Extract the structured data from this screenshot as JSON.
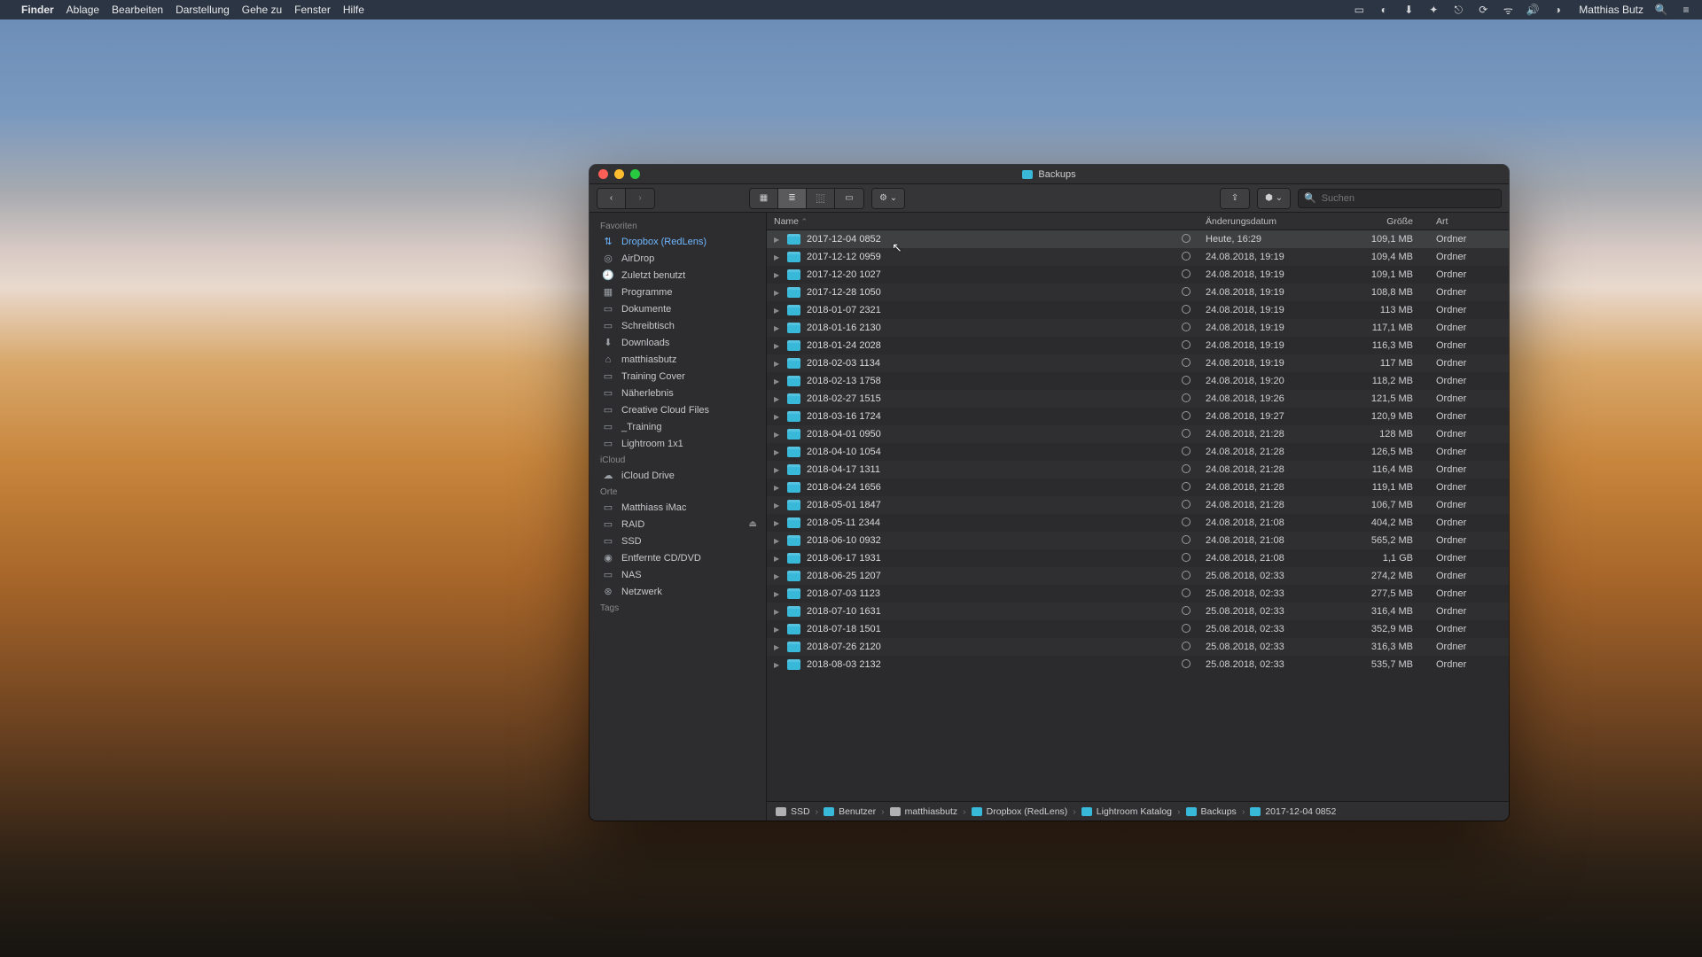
{
  "menubar": {
    "app": "Finder",
    "items": [
      "Ablage",
      "Bearbeiten",
      "Darstellung",
      "Gehe zu",
      "Fenster",
      "Hilfe"
    ],
    "user": "Matthias Butz"
  },
  "window": {
    "title": "Backups"
  },
  "toolbar": {
    "search_placeholder": "Suchen"
  },
  "sidebar": {
    "groups": {
      "fav": "Favoriten",
      "icloud": "iCloud",
      "orte": "Orte",
      "tags": "Tags"
    },
    "fav": [
      {
        "icon": "⇅",
        "label": "Dropbox (RedLens)",
        "sel": true
      },
      {
        "icon": "◎",
        "label": "AirDrop"
      },
      {
        "icon": "🕘",
        "label": "Zuletzt benutzt"
      },
      {
        "icon": "▦",
        "label": "Programme"
      },
      {
        "icon": "▭",
        "label": "Dokumente"
      },
      {
        "icon": "▭",
        "label": "Schreibtisch"
      },
      {
        "icon": "⬇",
        "label": "Downloads"
      },
      {
        "icon": "⌂",
        "label": "matthiasbutz"
      },
      {
        "icon": "▭",
        "label": "Training Cover"
      },
      {
        "icon": "▭",
        "label": "Näherlebnis"
      },
      {
        "icon": "▭",
        "label": "Creative Cloud Files"
      },
      {
        "icon": "▭",
        "label": "_Training"
      },
      {
        "icon": "▭",
        "label": "Lightroom 1x1"
      }
    ],
    "icloud": [
      {
        "icon": "☁",
        "label": "iCloud Drive"
      }
    ],
    "orte": [
      {
        "icon": "▭",
        "label": "Matthiass iMac"
      },
      {
        "icon": "▭",
        "label": "RAID",
        "eject": true
      },
      {
        "icon": "▭",
        "label": "SSD"
      },
      {
        "icon": "◉",
        "label": "Entfernte CD/DVD"
      },
      {
        "icon": "▭",
        "label": "NAS"
      },
      {
        "icon": "⊛",
        "label": "Netzwerk"
      }
    ]
  },
  "columns": {
    "name": "Name",
    "date": "Änderungsdatum",
    "size": "Größe",
    "kind": "Art"
  },
  "rows": [
    {
      "name": "2017-12-04 0852",
      "date": "Heute, 16:29",
      "size": "109,1 MB",
      "kind": "Ordner",
      "sel": true
    },
    {
      "name": "2017-12-12 0959",
      "date": "24.08.2018, 19:19",
      "size": "109,4 MB",
      "kind": "Ordner"
    },
    {
      "name": "2017-12-20 1027",
      "date": "24.08.2018, 19:19",
      "size": "109,1 MB",
      "kind": "Ordner"
    },
    {
      "name": "2017-12-28 1050",
      "date": "24.08.2018, 19:19",
      "size": "108,8 MB",
      "kind": "Ordner"
    },
    {
      "name": "2018-01-07 2321",
      "date": "24.08.2018, 19:19",
      "size": "113 MB",
      "kind": "Ordner"
    },
    {
      "name": "2018-01-16 2130",
      "date": "24.08.2018, 19:19",
      "size": "117,1 MB",
      "kind": "Ordner"
    },
    {
      "name": "2018-01-24 2028",
      "date": "24.08.2018, 19:19",
      "size": "116,3 MB",
      "kind": "Ordner"
    },
    {
      "name": "2018-02-03 1134",
      "date": "24.08.2018, 19:19",
      "size": "117 MB",
      "kind": "Ordner"
    },
    {
      "name": "2018-02-13 1758",
      "date": "24.08.2018, 19:20",
      "size": "118,2 MB",
      "kind": "Ordner"
    },
    {
      "name": "2018-02-27 1515",
      "date": "24.08.2018, 19:26",
      "size": "121,5 MB",
      "kind": "Ordner"
    },
    {
      "name": "2018-03-16 1724",
      "date": "24.08.2018, 19:27",
      "size": "120,9 MB",
      "kind": "Ordner"
    },
    {
      "name": "2018-04-01 0950",
      "date": "24.08.2018, 21:28",
      "size": "128 MB",
      "kind": "Ordner"
    },
    {
      "name": "2018-04-10 1054",
      "date": "24.08.2018, 21:28",
      "size": "126,5 MB",
      "kind": "Ordner"
    },
    {
      "name": "2018-04-17 1311",
      "date": "24.08.2018, 21:28",
      "size": "116,4 MB",
      "kind": "Ordner"
    },
    {
      "name": "2018-04-24 1656",
      "date": "24.08.2018, 21:28",
      "size": "119,1 MB",
      "kind": "Ordner"
    },
    {
      "name": "2018-05-01 1847",
      "date": "24.08.2018, 21:28",
      "size": "106,7 MB",
      "kind": "Ordner"
    },
    {
      "name": "2018-05-11 2344",
      "date": "24.08.2018, 21:08",
      "size": "404,2 MB",
      "kind": "Ordner"
    },
    {
      "name": "2018-06-10 0932",
      "date": "24.08.2018, 21:08",
      "size": "565,2 MB",
      "kind": "Ordner"
    },
    {
      "name": "2018-06-17 1931",
      "date": "24.08.2018, 21:08",
      "size": "1,1 GB",
      "kind": "Ordner"
    },
    {
      "name": "2018-06-25 1207",
      "date": "25.08.2018, 02:33",
      "size": "274,2 MB",
      "kind": "Ordner"
    },
    {
      "name": "2018-07-03 1123",
      "date": "25.08.2018, 02:33",
      "size": "277,5 MB",
      "kind": "Ordner"
    },
    {
      "name": "2018-07-10 1631",
      "date": "25.08.2018, 02:33",
      "size": "316,4 MB",
      "kind": "Ordner"
    },
    {
      "name": "2018-07-18 1501",
      "date": "25.08.2018, 02:33",
      "size": "352,9 MB",
      "kind": "Ordner"
    },
    {
      "name": "2018-07-26 2120",
      "date": "25.08.2018, 02:33",
      "size": "316,3 MB",
      "kind": "Ordner"
    },
    {
      "name": "2018-08-03 2132",
      "date": "25.08.2018, 02:33",
      "size": "535,7 MB",
      "kind": "Ordner"
    }
  ],
  "path": [
    {
      "label": "SSD",
      "color": "#b0b0b3"
    },
    {
      "label": "Benutzer",
      "color": "#38b9da"
    },
    {
      "label": "matthiasbutz",
      "color": "#b0b0b3"
    },
    {
      "label": "Dropbox (RedLens)",
      "color": "#38b9da"
    },
    {
      "label": "Lightroom Katalog",
      "color": "#38b9da"
    },
    {
      "label": "Backups",
      "color": "#38b9da"
    },
    {
      "label": "2017-12-04 0852",
      "color": "#38b9da"
    }
  ]
}
